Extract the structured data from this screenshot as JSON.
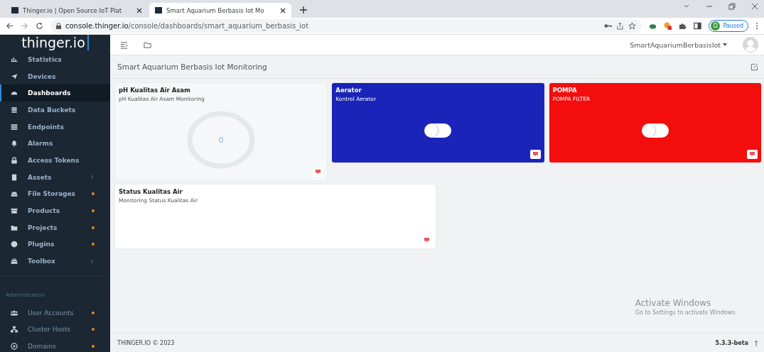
{
  "browser": {
    "tabs": [
      {
        "title": "Thinger.io | Open Source IoT Plat",
        "selected": false
      },
      {
        "title": "Smart Aquarium Berbasis Iot Mo",
        "selected": true
      }
    ],
    "url_host": "console.thinger.io",
    "url_path": "/console/dashboards/smart_aquarium_berbasis_iot",
    "profile_initial": "D",
    "profile_status": "Paused"
  },
  "sidebar": {
    "logo": "thinger.io",
    "items": [
      {
        "label": "Statistics",
        "selected": false
      },
      {
        "label": "Devices",
        "selected": false
      },
      {
        "label": "Dashboards",
        "selected": true
      },
      {
        "label": "Data Buckets",
        "selected": false
      },
      {
        "label": "Endpoints",
        "selected": false
      },
      {
        "label": "Alarms",
        "selected": false
      },
      {
        "label": "Access Tokens",
        "selected": false
      },
      {
        "label": "Assets",
        "selected": false,
        "submenu": true
      },
      {
        "label": "File Storages",
        "selected": false,
        "dot": true
      },
      {
        "label": "Products",
        "selected": false,
        "dot": true
      },
      {
        "label": "Projects",
        "selected": false,
        "dot": true
      },
      {
        "label": "Plugins",
        "selected": false,
        "dot": true
      },
      {
        "label": "Toolbox",
        "selected": false,
        "submenu": true
      }
    ],
    "section": "Administration",
    "admin_items": [
      {
        "label": "User Accounts",
        "selected": false,
        "dot": true
      },
      {
        "label": "Cluster Hosts",
        "selected": false,
        "dot": true
      },
      {
        "label": "Domains",
        "selected": false,
        "dot": true
      }
    ]
  },
  "header": {
    "user": "SmartAquariumBerbasisIot"
  },
  "dashboard": {
    "title": "Smart Aquarium Berbasis Iot Monitoring",
    "widgets": [
      {
        "kind": "donut",
        "title": "pH Kualitas Air Asam",
        "subtitle": "pH Kualitas Air Asam Monitoring",
        "value": "0"
      },
      {
        "kind": "toggle",
        "title": "Aerator",
        "subtitle": "Kontrol Aerator",
        "color": "#1a24b9",
        "on": false
      },
      {
        "kind": "toggle",
        "title": "POMPA",
        "subtitle": "POMPA FILTER",
        "color": "#f40d0d",
        "on": false
      },
      {
        "kind": "blank",
        "title": "Status Kualitas Air",
        "subtitle": "Monitoring Status Kualitas Air"
      }
    ]
  },
  "footer": {
    "copyright": "THINGER.IO © 2023",
    "version": "5.3.3-beta"
  },
  "os_notice": {
    "title": "Activate Windows",
    "text": "Go to Settings to activate Windows."
  }
}
